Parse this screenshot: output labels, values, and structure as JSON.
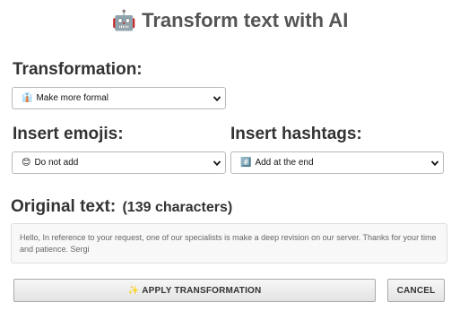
{
  "title": {
    "emoji": "🤖",
    "text": "Transform text with AI"
  },
  "transformation": {
    "label": "Transformation:",
    "selected_emoji": "👔",
    "selected": "Make more formal"
  },
  "emojis": {
    "label": "Insert emojis:",
    "selected_emoji": "😊",
    "selected": "Do not add"
  },
  "hashtags": {
    "label": "Insert hashtags:",
    "selected_emoji": "#️⃣",
    "selected": "Add at the end"
  },
  "original": {
    "label": "Original text:",
    "count": "(139 characters)",
    "text": "Hello, In reference to your request, one of our specialists is make a deep revision on our server. Thanks for your time and patience. Sergi"
  },
  "buttons": {
    "apply_emoji": "✨",
    "apply": "APPLY TRANSFORMATION",
    "cancel": "CANCEL"
  },
  "icons": {
    "select_arrow": "chevron-down-icon"
  }
}
